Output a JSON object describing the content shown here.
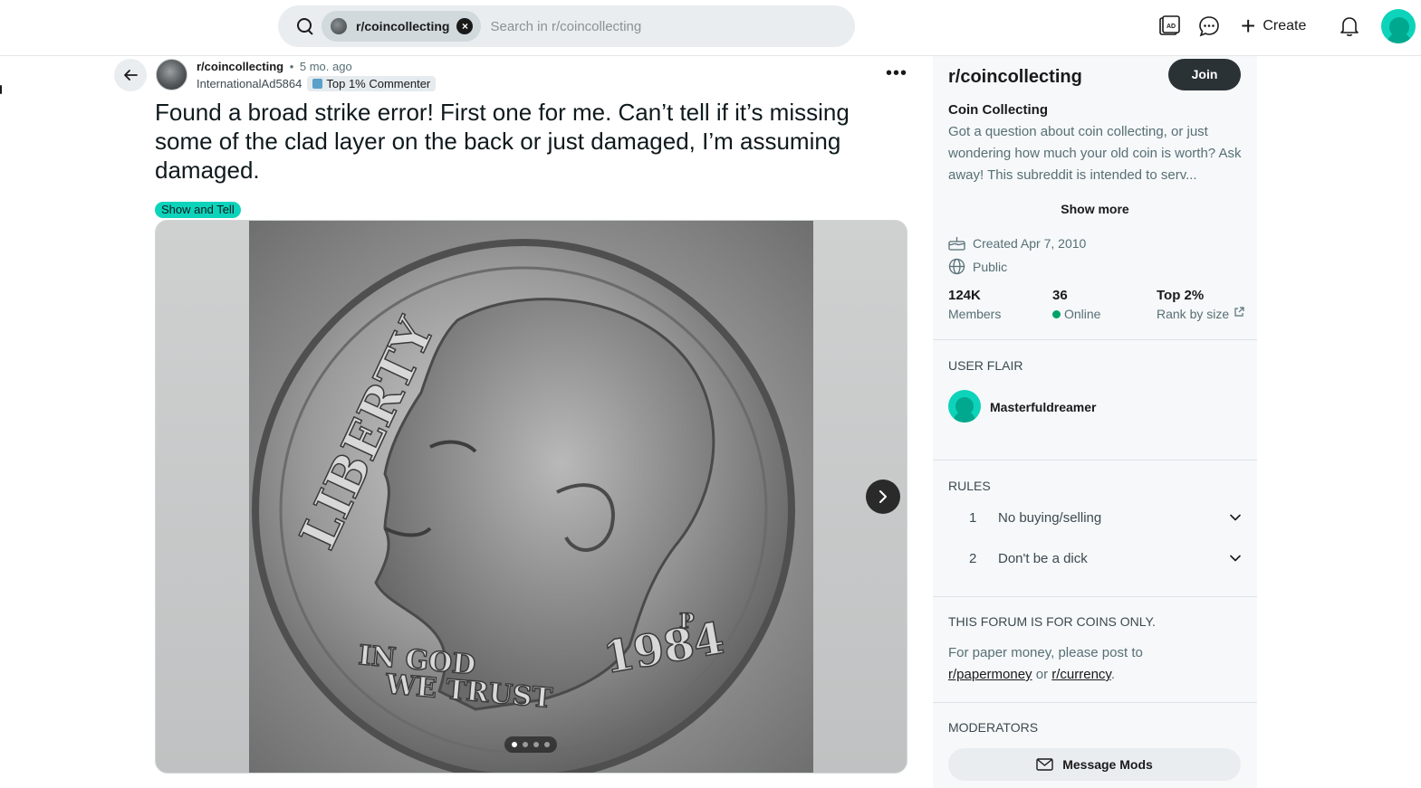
{
  "search": {
    "chip_label": "r/coincollecting",
    "placeholder": "Search in r/coincollecting"
  },
  "header": {
    "create_label": "Create",
    "icons": [
      "advertise-icon",
      "chat-icon",
      "plus-icon",
      "bell-icon",
      "user-avatar"
    ]
  },
  "post": {
    "subreddit": "r/coincollecting",
    "separator": "•",
    "age": "5 mo. ago",
    "author": "InternationalAd5864",
    "author_flair": "Top 1% Commenter",
    "title": "Found a broad strike error! First one for me. Can’t tell if it’s missing some of the clad layer on the back or just damaged, I’m assuming damaged.",
    "tag": "Show and Tell",
    "more_label": "•••",
    "gallery": {
      "count": 4,
      "current": 1
    }
  },
  "sidebar": {
    "name": "r/coincollecting",
    "join_label": "Join",
    "title": "Coin Collecting",
    "description": "Got a question about coin collecting, or just wondering how much your old coin is worth? Ask away! This subreddit is intended to serv...",
    "show_more": "Show more",
    "created": "Created Apr 7, 2010",
    "visibility": "Public",
    "stats": [
      {
        "value": "124K",
        "label": "Members"
      },
      {
        "value": "36",
        "label": "Online"
      },
      {
        "value": "Top 2%",
        "label": "Rank by size"
      }
    ],
    "user_flair_heading": "USER FLAIR",
    "user_flair_name": "Masterfuldreamer",
    "rules_heading": "RULES",
    "rules": [
      {
        "num": "1",
        "text": "No buying/selling"
      },
      {
        "num": "2",
        "text": "Don't be a dick"
      }
    ],
    "forum_heading": "THIS FORUM IS FOR COINS ONLY.",
    "forum_text_prefix": "For paper money, please post to",
    "forum_link1": "r/papermoney",
    "forum_or": "or",
    "forum_link2": "r/currency",
    "forum_end": ".",
    "moderators_heading": "MODERATORS",
    "message_mods": "Message Mods"
  },
  "colors": {
    "accent": "#0dd3bb",
    "join_bg": "#2a3236",
    "online": "#01a368"
  }
}
